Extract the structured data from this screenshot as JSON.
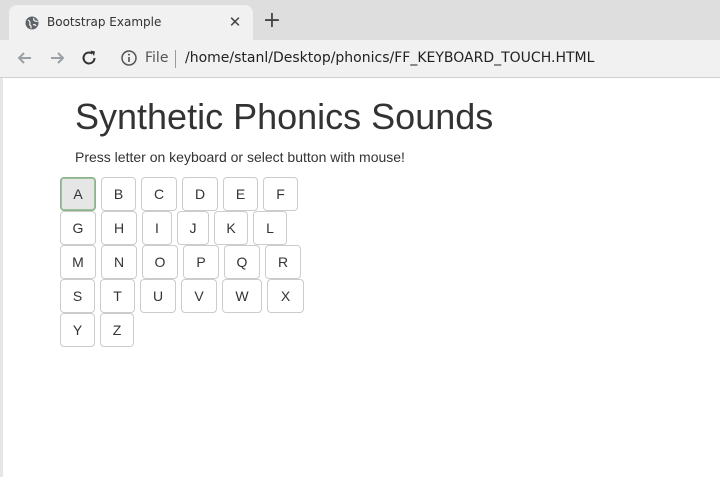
{
  "browser": {
    "tab_title": "Bootstrap Example",
    "tab_close_glyph": "✕",
    "new_tab_glyph": "+",
    "scheme_label": "File",
    "url": "/home/stanl/Desktop/phonics/FF_KEYBOARD_TOUCH.HTML",
    "icons": [
      "globe-icon",
      "back-arrow-icon",
      "forward-arrow-icon",
      "reload-icon",
      "info-icon"
    ]
  },
  "page": {
    "title": "Synthetic Phonics Sounds",
    "instructions": "Press letter on keyboard or select button with mouse!",
    "rows": [
      [
        "A",
        "B",
        "C",
        "D",
        "E",
        "F"
      ],
      [
        "G",
        "H",
        "I",
        "J",
        "K",
        "L"
      ],
      [
        "M",
        "N",
        "O",
        "P",
        "Q",
        "R"
      ],
      [
        "S",
        "T",
        "U",
        "V",
        "W",
        "X"
      ],
      [
        "Y",
        "Z"
      ]
    ],
    "focused_key": "A"
  },
  "colors": {
    "tabstrip": "#dedede",
    "toolbar": "#f1f1f1",
    "text": "#333333",
    "key_border": "#cccccc",
    "active_border": "#8fb08f"
  }
}
